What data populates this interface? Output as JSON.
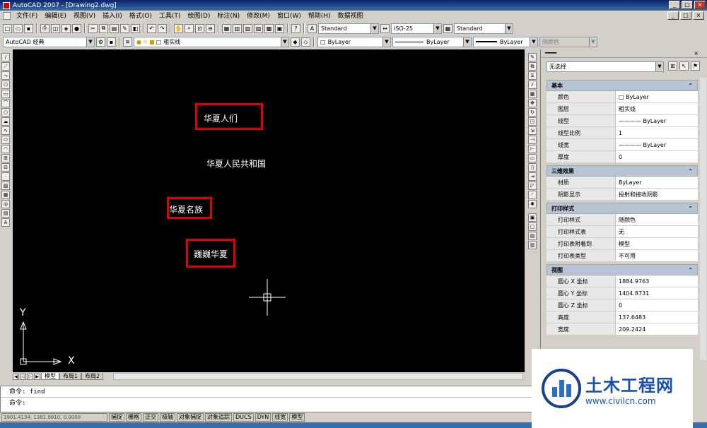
{
  "window": {
    "title": "AutoCAD 2007 - [Drawing2.dwg]",
    "minimize": "_",
    "restore": "□",
    "close": "×"
  },
  "menu": [
    "文件(F)",
    "编辑(E)",
    "视图(V)",
    "插入(I)",
    "格式(O)",
    "工具(T)",
    "绘图(D)",
    "标注(N)",
    "修改(M)",
    "窗口(W)",
    "帮助(H)",
    "数据视图"
  ],
  "toolbar": {
    "text_style": "Standard",
    "dim_style": "ISO-25",
    "table_style": "Standard",
    "workspace": "AutoCAD 经典",
    "layer": "粗实线",
    "color": "ByLayer",
    "linetype": "ByLayer",
    "lineweight": "ByLayer",
    "plotstyle": "随颜色"
  },
  "canvas": {
    "texts": [
      "华夏人们",
      "华夏人民共和国",
      "华夏名族",
      "巍巍华夏"
    ],
    "ucs_x": "X",
    "ucs_y": "Y"
  },
  "tabs": [
    "模型",
    "布局1",
    "布局2"
  ],
  "command": {
    "history": "命令: find",
    "prompt": "命令:"
  },
  "status": {
    "coords": "1901.4134, 1381.9810, 0.0000",
    "buttons": [
      "捕捉",
      "栅格",
      "正交",
      "极轴",
      "对象捕捉",
      "对象追踪",
      "DUCS",
      "DYN",
      "线宽",
      "模型"
    ]
  },
  "properties": {
    "selection": "无选择",
    "sections": [
      {
        "title": "基本",
        "rows": [
          {
            "name": "颜色",
            "value": "□ ByLayer"
          },
          {
            "name": "图层",
            "value": "粗实线"
          },
          {
            "name": "线型",
            "value": "———— ByLayer"
          },
          {
            "name": "线型比例",
            "value": "1"
          },
          {
            "name": "线宽",
            "value": "———— ByLayer"
          },
          {
            "name": "厚度",
            "value": "0"
          }
        ]
      },
      {
        "title": "三维效果",
        "rows": [
          {
            "name": "材质",
            "value": "ByLayer"
          },
          {
            "name": "阴影显示",
            "value": "投射和接收阴影"
          }
        ]
      },
      {
        "title": "打印样式",
        "rows": [
          {
            "name": "打印样式",
            "value": "随颜色"
          },
          {
            "name": "打印样式表",
            "value": "无"
          },
          {
            "name": "打印表附着到",
            "value": "模型"
          },
          {
            "name": "打印表类型",
            "value": "不可用"
          }
        ]
      },
      {
        "title": "视图",
        "rows": [
          {
            "name": "圆心 X 坐标",
            "value": "1884.9763"
          },
          {
            "name": "圆心 Y 坐标",
            "value": "1404.8731"
          },
          {
            "name": "圆心 Z 坐标",
            "value": "0"
          },
          {
            "name": "高度",
            "value": "137.6483"
          },
          {
            "name": "宽度",
            "value": "209.2424"
          }
        ]
      }
    ]
  },
  "watermark": {
    "title": "土木工程网",
    "url": "www.civilcn.com"
  },
  "colors": {
    "highlight": "#e00000",
    "canvas": "#000000",
    "watermark": "#1a4fb0"
  }
}
